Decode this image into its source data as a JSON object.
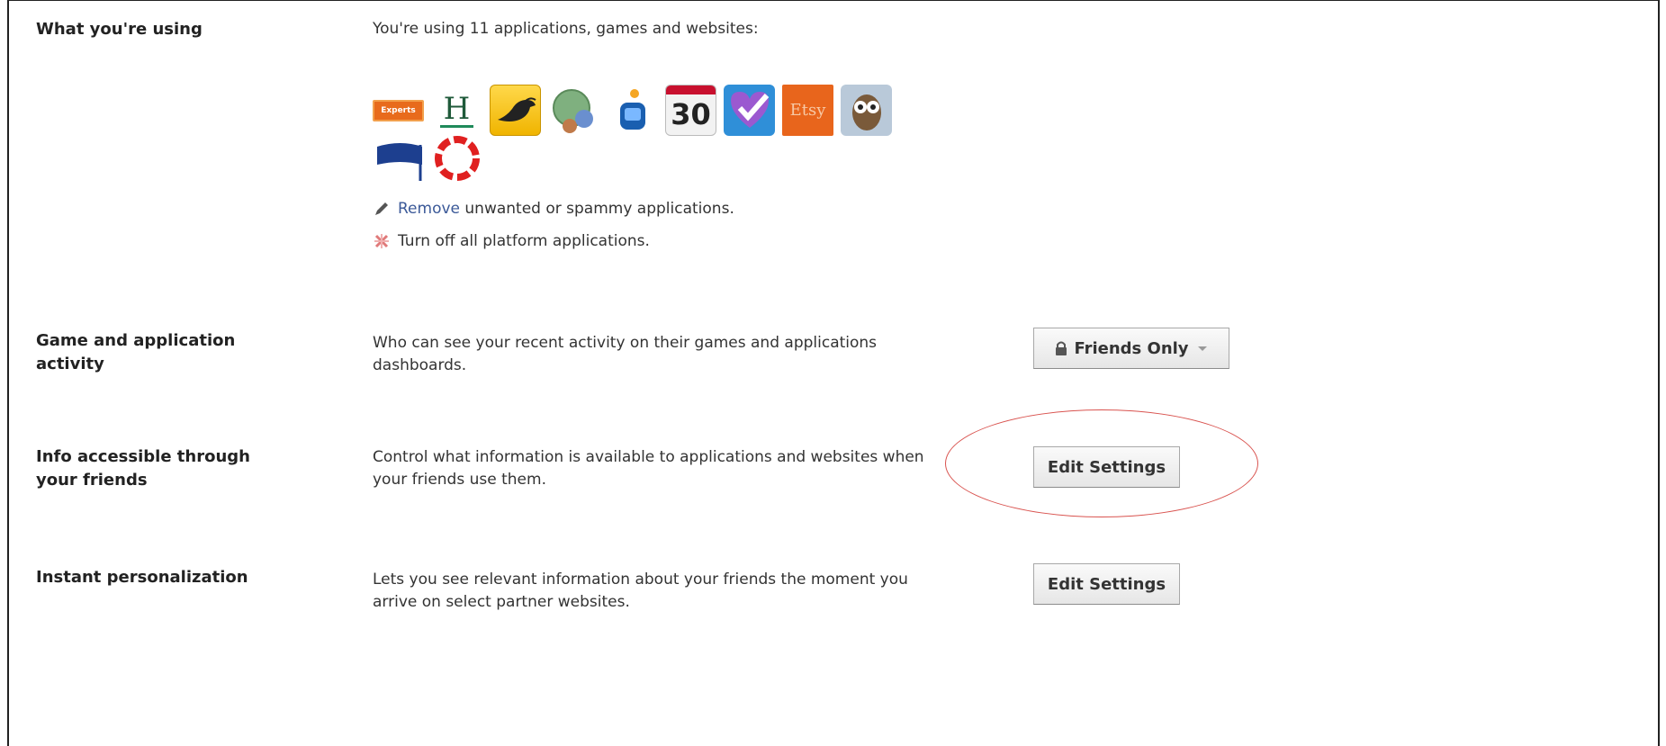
{
  "sections": {
    "using": {
      "label": "What you're using",
      "desc": "You're using 11 applications, games and websites:",
      "remove_link": "Remove",
      "remove_rest": " unwanted or spammy applications.",
      "turnoff_link": "Turn off",
      "turnoff_rest": " all platform applications."
    },
    "game": {
      "label": "Game and application activity",
      "desc": "Who can see your recent activity on their games and applications dashboards.",
      "button": "Friends Only"
    },
    "friends": {
      "label": "Info accessible through your friends",
      "desc": "Control what information is available to applications and websites when your friends use them.",
      "button": "Edit Settings"
    },
    "instant": {
      "label": "Instant personalization",
      "desc": "Lets you see relevant information about your friends the moment you arrive on select partner websites.",
      "button": "Edit Settings"
    }
  },
  "apps": [
    {
      "name": "badge-app-icon",
      "text": "Experts"
    },
    {
      "name": "h-app-icon",
      "text": "H"
    },
    {
      "name": "bird-app-icon",
      "text": ""
    },
    {
      "name": "globe-people-app-icon",
      "text": ""
    },
    {
      "name": "tv-app-icon",
      "text": ""
    },
    {
      "name": "calendar-app-icon",
      "text": "30"
    },
    {
      "name": "heart-check-app-icon",
      "text": ""
    },
    {
      "name": "etsy-app-icon",
      "text": "Etsy"
    },
    {
      "name": "owl-app-icon",
      "text": ""
    },
    {
      "name": "flag-app-icon",
      "text": ""
    },
    {
      "name": "red-ring-app-icon",
      "text": ""
    }
  ],
  "colors": {
    "link": "#3b5998",
    "annotation": "#d9534f"
  }
}
